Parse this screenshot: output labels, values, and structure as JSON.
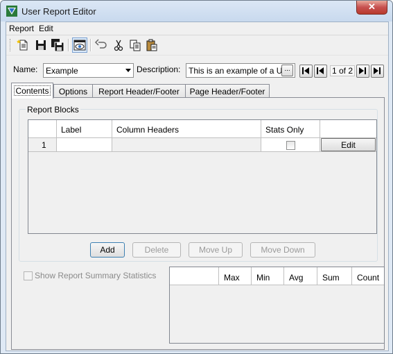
{
  "window": {
    "title": "User Report Editor",
    "close_glyph": "✕"
  },
  "menu": {
    "items": [
      "Report",
      "Edit"
    ]
  },
  "toolbar": {
    "buttons": [
      "new-icon",
      "save-icon",
      "save-all-icon",
      "preview-icon",
      "undo-icon",
      "cut-icon",
      "copy-icon",
      "paste-icon"
    ]
  },
  "form": {
    "name_label": "Name:",
    "name_value": "Example",
    "description_label": "Description:",
    "description_value": "This is an example of a U",
    "ellipsis": "...",
    "page_indicator": "1 of 2"
  },
  "tabs": [
    "Contents",
    "Options",
    "Report Header/Footer",
    "Page Header/Footer"
  ],
  "report_blocks": {
    "title": "Report Blocks",
    "columns": [
      "",
      "Label",
      "Column Headers",
      "Stats Only",
      ""
    ],
    "rows": [
      {
        "num": "1",
        "label": "",
        "column_headers": "",
        "stats_only": false,
        "action": "Edit"
      }
    ],
    "buttons": {
      "add": "Add",
      "delete": "Delete",
      "move_up": "Move Up",
      "move_down": "Move Down"
    }
  },
  "summary": {
    "checkbox_label": "Show Report Summary Statistics",
    "columns": [
      "",
      "Max",
      "Min",
      "Avg",
      "Sum",
      "Count"
    ]
  },
  "colors": {
    "title_bar": "#c8d9ee",
    "close_button": "#c75050",
    "panel": "#f0f0f0"
  }
}
